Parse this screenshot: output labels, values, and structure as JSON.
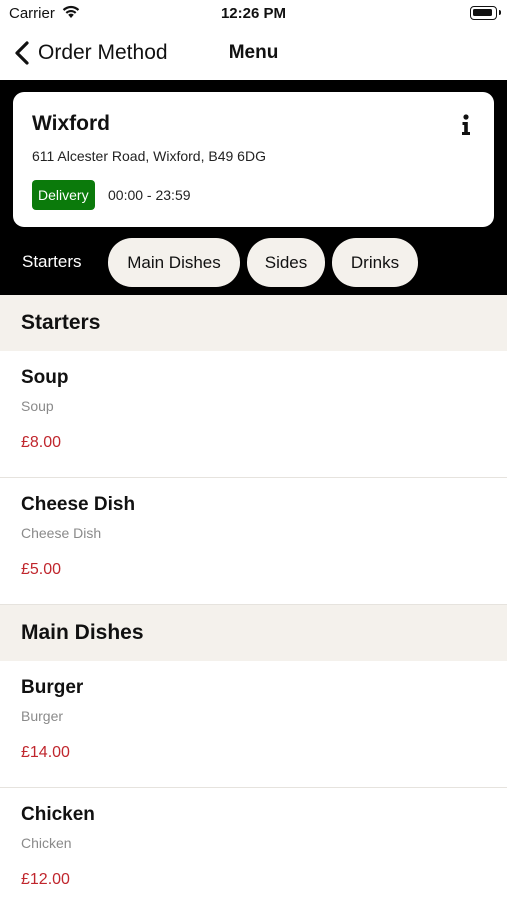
{
  "status_bar": {
    "carrier": "Carrier",
    "time": "12:26 PM"
  },
  "nav": {
    "back_label": "Order Method",
    "title": "Menu"
  },
  "store": {
    "name": "Wixford",
    "address": "611 Alcester Road, Wixford, B49 6DG",
    "badge": "Delivery",
    "badge_color": "#0b7a0b",
    "hours": "00:00 - 23:59"
  },
  "tabs": [
    "Starters",
    "Main Dishes",
    "Sides",
    "Drinks"
  ],
  "sections": [
    {
      "title": "Starters",
      "items": [
        {
          "name": "Soup",
          "description": "Soup",
          "price": "£8.00"
        },
        {
          "name": "Cheese Dish",
          "description": "Cheese Dish",
          "price": "£5.00"
        }
      ]
    },
    {
      "title": "Main Dishes",
      "items": [
        {
          "name": "Burger",
          "description": "Burger",
          "price": "£14.00"
        },
        {
          "name": "Chicken",
          "description": "Chicken",
          "price": "£12.00"
        }
      ]
    }
  ],
  "colors": {
    "price": "#c0262d",
    "section_bg": "#f4f1ec",
    "header_bg": "#000000"
  }
}
